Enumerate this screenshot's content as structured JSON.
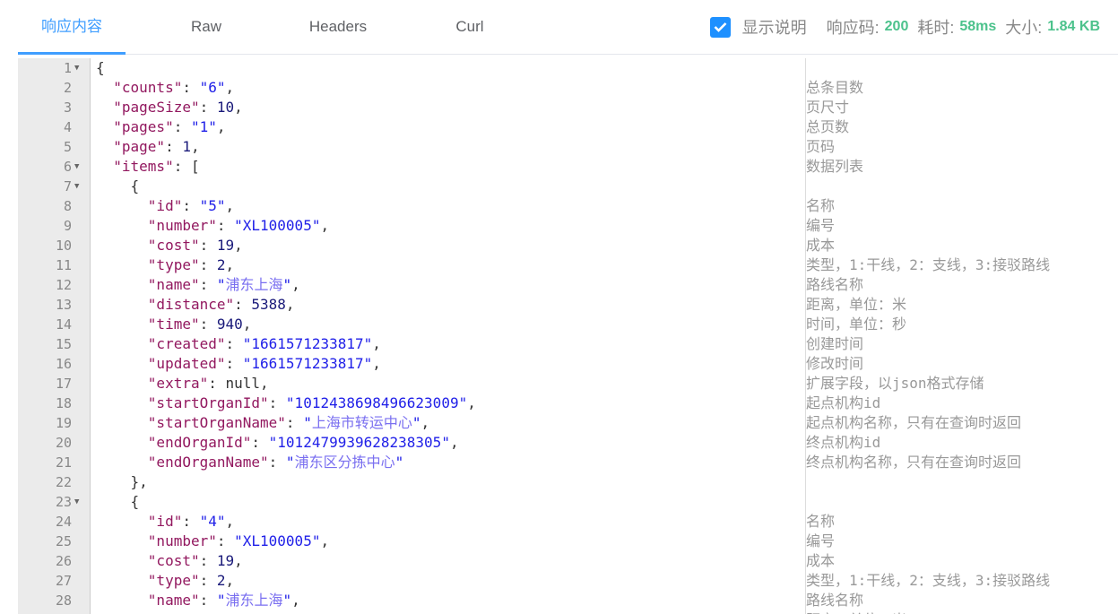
{
  "tabs": [
    {
      "label": "响应内容",
      "active": true
    },
    {
      "label": "Raw"
    },
    {
      "label": "Headers"
    },
    {
      "label": "Curl"
    }
  ],
  "status": {
    "show_desc_label": "显示说明",
    "show_desc_checked": true,
    "code_label": "响应码:",
    "code_value": "200",
    "time_label": "耗时:",
    "time_value": "58ms",
    "size_label": "大小:",
    "size_value": "1.84 KB"
  },
  "colors": {
    "accent": "#409eff",
    "status_value": "#4cc28c",
    "key": "#92185f",
    "string": "#2020e8"
  },
  "lines": [
    {
      "n": "1",
      "fold": true,
      "seg": [
        [
          "p",
          "{"
        ]
      ],
      "c": ""
    },
    {
      "n": "2",
      "seg": [
        [
          "p",
          "  "
        ],
        [
          "k",
          "\"counts\""
        ],
        [
          "p",
          ": "
        ],
        [
          "s",
          "\"6\""
        ],
        [
          "p",
          ","
        ]
      ],
      "c": "总条目数"
    },
    {
      "n": "3",
      "seg": [
        [
          "p",
          "  "
        ],
        [
          "k",
          "\"pageSize\""
        ],
        [
          "p",
          ": "
        ],
        [
          "n",
          "10"
        ],
        [
          "p",
          ","
        ]
      ],
      "c": "页尺寸"
    },
    {
      "n": "4",
      "seg": [
        [
          "p",
          "  "
        ],
        [
          "k",
          "\"pages\""
        ],
        [
          "p",
          ": "
        ],
        [
          "s",
          "\"1\""
        ],
        [
          "p",
          ","
        ]
      ],
      "c": "总页数"
    },
    {
      "n": "5",
      "seg": [
        [
          "p",
          "  "
        ],
        [
          "k",
          "\"page\""
        ],
        [
          "p",
          ": "
        ],
        [
          "n",
          "1"
        ],
        [
          "p",
          ","
        ]
      ],
      "c": "页码"
    },
    {
      "n": "6",
      "fold": true,
      "seg": [
        [
          "p",
          "  "
        ],
        [
          "k",
          "\"items\""
        ],
        [
          "p",
          ": ["
        ]
      ],
      "c": "数据列表"
    },
    {
      "n": "7",
      "fold": true,
      "seg": [
        [
          "p",
          "    {"
        ]
      ],
      "c": ""
    },
    {
      "n": "8",
      "seg": [
        [
          "p",
          "      "
        ],
        [
          "k",
          "\"id\""
        ],
        [
          "p",
          ": "
        ],
        [
          "s",
          "\"5\""
        ],
        [
          "p",
          ","
        ]
      ],
      "c": "名称"
    },
    {
      "n": "9",
      "seg": [
        [
          "p",
          "      "
        ],
        [
          "k",
          "\"number\""
        ],
        [
          "p",
          ": "
        ],
        [
          "s",
          "\"XL100005\""
        ],
        [
          "p",
          ","
        ]
      ],
      "c": "编号"
    },
    {
      "n": "10",
      "seg": [
        [
          "p",
          "      "
        ],
        [
          "k",
          "\"cost\""
        ],
        [
          "p",
          ": "
        ],
        [
          "n",
          "19"
        ],
        [
          "p",
          ","
        ]
      ],
      "c": "成本"
    },
    {
      "n": "11",
      "seg": [
        [
          "p",
          "      "
        ],
        [
          "k",
          "\"type\""
        ],
        [
          "p",
          ": "
        ],
        [
          "n",
          "2"
        ],
        [
          "p",
          ","
        ]
      ],
      "c": "类型，1:干线，2：支线，3:接驳路线"
    },
    {
      "n": "12",
      "seg": [
        [
          "p",
          "      "
        ],
        [
          "k",
          "\"name\""
        ],
        [
          "p",
          ": "
        ],
        [
          "s",
          "\""
        ],
        [
          "cn",
          "浦东上海"
        ],
        [
          "s",
          "\""
        ],
        [
          "p",
          ","
        ]
      ],
      "c": "路线名称"
    },
    {
      "n": "13",
      "seg": [
        [
          "p",
          "      "
        ],
        [
          "k",
          "\"distance\""
        ],
        [
          "p",
          ": "
        ],
        [
          "n",
          "5388"
        ],
        [
          "p",
          ","
        ]
      ],
      "c": "距离，单位：米"
    },
    {
      "n": "14",
      "seg": [
        [
          "p",
          "      "
        ],
        [
          "k",
          "\"time\""
        ],
        [
          "p",
          ": "
        ],
        [
          "n",
          "940"
        ],
        [
          "p",
          ","
        ]
      ],
      "c": "时间，单位：秒"
    },
    {
      "n": "15",
      "seg": [
        [
          "p",
          "      "
        ],
        [
          "k",
          "\"created\""
        ],
        [
          "p",
          ": "
        ],
        [
          "s",
          "\"1661571233817\""
        ],
        [
          "p",
          ","
        ]
      ],
      "c": "创建时间"
    },
    {
      "n": "16",
      "seg": [
        [
          "p",
          "      "
        ],
        [
          "k",
          "\"updated\""
        ],
        [
          "p",
          ": "
        ],
        [
          "s",
          "\"1661571233817\""
        ],
        [
          "p",
          ","
        ]
      ],
      "c": "修改时间"
    },
    {
      "n": "17",
      "seg": [
        [
          "p",
          "      "
        ],
        [
          "k",
          "\"extra\""
        ],
        [
          "p",
          ": null,"
        ]
      ],
      "c": "扩展字段，以json格式存储"
    },
    {
      "n": "18",
      "seg": [
        [
          "p",
          "      "
        ],
        [
          "k",
          "\"startOrganId\""
        ],
        [
          "p",
          ": "
        ],
        [
          "s",
          "\"1012438698496623009\""
        ],
        [
          "p",
          ","
        ]
      ],
      "c": "起点机构id"
    },
    {
      "n": "19",
      "seg": [
        [
          "p",
          "      "
        ],
        [
          "k",
          "\"startOrganName\""
        ],
        [
          "p",
          ": "
        ],
        [
          "s",
          "\""
        ],
        [
          "cn",
          "上海市转运中心"
        ],
        [
          "s",
          "\""
        ],
        [
          "p",
          ","
        ]
      ],
      "c": "起点机构名称，只有在查询时返回"
    },
    {
      "n": "20",
      "seg": [
        [
          "p",
          "      "
        ],
        [
          "k",
          "\"endOrganId\""
        ],
        [
          "p",
          ": "
        ],
        [
          "s",
          "\"1012479939628238305\""
        ],
        [
          "p",
          ","
        ]
      ],
      "c": "终点机构id"
    },
    {
      "n": "21",
      "seg": [
        [
          "p",
          "      "
        ],
        [
          "k",
          "\"endOrganName\""
        ],
        [
          "p",
          ": "
        ],
        [
          "s",
          "\""
        ],
        [
          "cn",
          "浦东区分拣中心"
        ],
        [
          "s",
          "\""
        ]
      ],
      "c": "终点机构名称，只有在查询时返回"
    },
    {
      "n": "22",
      "seg": [
        [
          "p",
          "    },"
        ]
      ],
      "c": ""
    },
    {
      "n": "23",
      "fold": true,
      "seg": [
        [
          "p",
          "    {"
        ]
      ],
      "c": ""
    },
    {
      "n": "24",
      "seg": [
        [
          "p",
          "      "
        ],
        [
          "k",
          "\"id\""
        ],
        [
          "p",
          ": "
        ],
        [
          "s",
          "\"4\""
        ],
        [
          "p",
          ","
        ]
      ],
      "c": "名称"
    },
    {
      "n": "25",
      "seg": [
        [
          "p",
          "      "
        ],
        [
          "k",
          "\"number\""
        ],
        [
          "p",
          ": "
        ],
        [
          "s",
          "\"XL100005\""
        ],
        [
          "p",
          ","
        ]
      ],
      "c": "编号"
    },
    {
      "n": "26",
      "seg": [
        [
          "p",
          "      "
        ],
        [
          "k",
          "\"cost\""
        ],
        [
          "p",
          ": "
        ],
        [
          "n",
          "19"
        ],
        [
          "p",
          ","
        ]
      ],
      "c": "成本"
    },
    {
      "n": "27",
      "seg": [
        [
          "p",
          "      "
        ],
        [
          "k",
          "\"type\""
        ],
        [
          "p",
          ": "
        ],
        [
          "n",
          "2"
        ],
        [
          "p",
          ","
        ]
      ],
      "c": "类型，1:干线，2：支线，3:接驳路线"
    },
    {
      "n": "28",
      "seg": [
        [
          "p",
          "      "
        ],
        [
          "k",
          "\"name\""
        ],
        [
          "p",
          ": "
        ],
        [
          "s",
          "\""
        ],
        [
          "cn",
          "浦东上海"
        ],
        [
          "s",
          "\""
        ],
        [
          "p",
          ","
        ]
      ],
      "c": "路线名称"
    },
    {
      "n": "",
      "seg": [],
      "c": "距离，单位：米"
    }
  ]
}
